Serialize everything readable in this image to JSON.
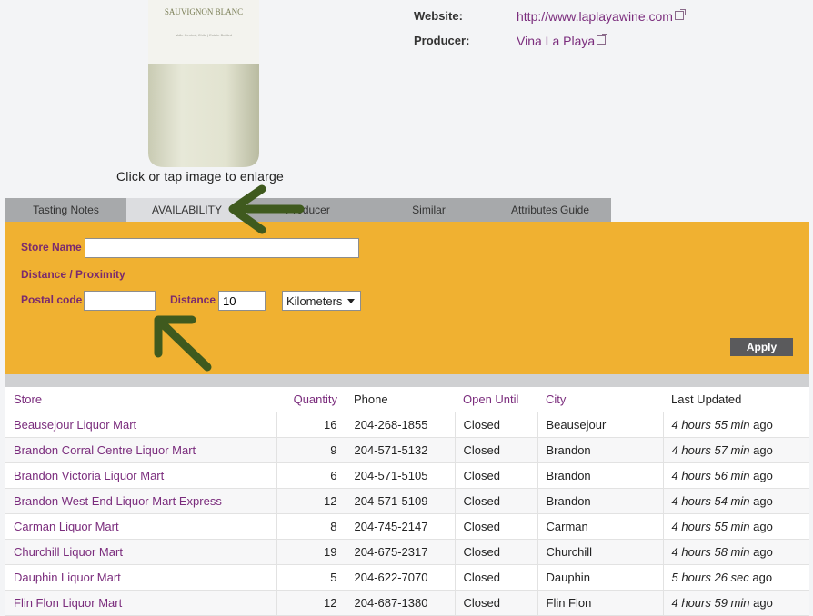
{
  "product": {
    "bottle_label": "SAUVIGNON BLANC",
    "bottle_sublabel": "Valle Central, Chile | Estate Bottled",
    "caption": "Click or tap image to enlarge",
    "website_label": "Website:",
    "website_value": "http://www.laplayawine.com",
    "producer_label": "Producer:",
    "producer_value": "Vina La Playa"
  },
  "tabs": [
    {
      "label": "Tasting Notes",
      "active": false
    },
    {
      "label": "AVAILABILITY",
      "active": true
    },
    {
      "label": "Producer",
      "active": false
    },
    {
      "label": "Similar",
      "active": false
    },
    {
      "label": "Attributes Guide",
      "active": false
    }
  ],
  "filters": {
    "store_name_label": "Store Name",
    "store_name_value": "",
    "distance_heading": "Distance / Proximity",
    "postal_code_label": "Postal code",
    "postal_code_value": "",
    "distance_label": "Distance",
    "distance_value": "10",
    "unit_selected": "Kilometers",
    "apply_label": "Apply"
  },
  "table": {
    "headers": [
      "Store",
      "Quantity",
      "Phone",
      "Open Until",
      "City",
      "Last Updated"
    ],
    "rows": [
      {
        "store": "Beausejour Liquor Mart",
        "qty": "16",
        "phone": "204-268-1855",
        "open": "Closed",
        "city": "Beausejour",
        "updated": "4 hours 55 min",
        "ago": "ago"
      },
      {
        "store": "Brandon Corral Centre Liquor Mart",
        "qty": "9",
        "phone": "204-571-5132",
        "open": "Closed",
        "city": "Brandon",
        "updated": "4 hours 57 min",
        "ago": "ago"
      },
      {
        "store": "Brandon Victoria Liquor Mart",
        "qty": "6",
        "phone": "204-571-5105",
        "open": "Closed",
        "city": "Brandon",
        "updated": "4 hours 56 min",
        "ago": "ago"
      },
      {
        "store": "Brandon West End Liquor Mart Express",
        "qty": "12",
        "phone": "204-571-5109",
        "open": "Closed",
        "city": "Brandon",
        "updated": "4 hours 54 min",
        "ago": "ago"
      },
      {
        "store": "Carman Liquor Mart",
        "qty": "8",
        "phone": "204-745-2147",
        "open": "Closed",
        "city": "Carman",
        "updated": "4 hours 55 min",
        "ago": "ago"
      },
      {
        "store": "Churchill Liquor Mart",
        "qty": "19",
        "phone": "204-675-2317",
        "open": "Closed",
        "city": "Churchill",
        "updated": "4 hours 58 min",
        "ago": "ago"
      },
      {
        "store": "Dauphin Liquor Mart",
        "qty": "5",
        "phone": "204-622-7070",
        "open": "Closed",
        "city": "Dauphin",
        "updated": "5 hours 26 sec",
        "ago": "ago"
      },
      {
        "store": "Flin Flon Liquor Mart",
        "qty": "12",
        "phone": "204-687-1380",
        "open": "Closed",
        "city": "Flin Flon",
        "updated": "4 hours 59 min",
        "ago": "ago"
      }
    ]
  },
  "colors": {
    "panel": "#f0b131",
    "link": "#7b2d7d",
    "arrow": "#3f5a1e"
  }
}
